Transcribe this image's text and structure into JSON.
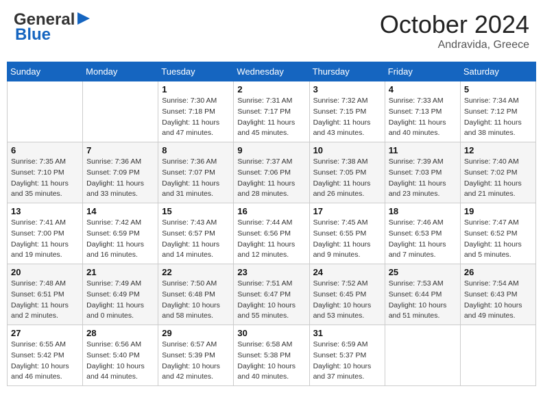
{
  "header": {
    "logo_line1": "General",
    "logo_line2": "Blue",
    "month_title": "October 2024",
    "location": "Andravida, Greece"
  },
  "calendar": {
    "days_of_week": [
      "Sunday",
      "Monday",
      "Tuesday",
      "Wednesday",
      "Thursday",
      "Friday",
      "Saturday"
    ],
    "weeks": [
      [
        {
          "day": "",
          "sunrise": "",
          "sunset": "",
          "daylight": ""
        },
        {
          "day": "",
          "sunrise": "",
          "sunset": "",
          "daylight": ""
        },
        {
          "day": "1",
          "sunrise": "Sunrise: 7:30 AM",
          "sunset": "Sunset: 7:18 PM",
          "daylight": "Daylight: 11 hours and 47 minutes."
        },
        {
          "day": "2",
          "sunrise": "Sunrise: 7:31 AM",
          "sunset": "Sunset: 7:17 PM",
          "daylight": "Daylight: 11 hours and 45 minutes."
        },
        {
          "day": "3",
          "sunrise": "Sunrise: 7:32 AM",
          "sunset": "Sunset: 7:15 PM",
          "daylight": "Daylight: 11 hours and 43 minutes."
        },
        {
          "day": "4",
          "sunrise": "Sunrise: 7:33 AM",
          "sunset": "Sunset: 7:13 PM",
          "daylight": "Daylight: 11 hours and 40 minutes."
        },
        {
          "day": "5",
          "sunrise": "Sunrise: 7:34 AM",
          "sunset": "Sunset: 7:12 PM",
          "daylight": "Daylight: 11 hours and 38 minutes."
        }
      ],
      [
        {
          "day": "6",
          "sunrise": "Sunrise: 7:35 AM",
          "sunset": "Sunset: 7:10 PM",
          "daylight": "Daylight: 11 hours and 35 minutes."
        },
        {
          "day": "7",
          "sunrise": "Sunrise: 7:36 AM",
          "sunset": "Sunset: 7:09 PM",
          "daylight": "Daylight: 11 hours and 33 minutes."
        },
        {
          "day": "8",
          "sunrise": "Sunrise: 7:36 AM",
          "sunset": "Sunset: 7:07 PM",
          "daylight": "Daylight: 11 hours and 31 minutes."
        },
        {
          "day": "9",
          "sunrise": "Sunrise: 7:37 AM",
          "sunset": "Sunset: 7:06 PM",
          "daylight": "Daylight: 11 hours and 28 minutes."
        },
        {
          "day": "10",
          "sunrise": "Sunrise: 7:38 AM",
          "sunset": "Sunset: 7:05 PM",
          "daylight": "Daylight: 11 hours and 26 minutes."
        },
        {
          "day": "11",
          "sunrise": "Sunrise: 7:39 AM",
          "sunset": "Sunset: 7:03 PM",
          "daylight": "Daylight: 11 hours and 23 minutes."
        },
        {
          "day": "12",
          "sunrise": "Sunrise: 7:40 AM",
          "sunset": "Sunset: 7:02 PM",
          "daylight": "Daylight: 11 hours and 21 minutes."
        }
      ],
      [
        {
          "day": "13",
          "sunrise": "Sunrise: 7:41 AM",
          "sunset": "Sunset: 7:00 PM",
          "daylight": "Daylight: 11 hours and 19 minutes."
        },
        {
          "day": "14",
          "sunrise": "Sunrise: 7:42 AM",
          "sunset": "Sunset: 6:59 PM",
          "daylight": "Daylight: 11 hours and 16 minutes."
        },
        {
          "day": "15",
          "sunrise": "Sunrise: 7:43 AM",
          "sunset": "Sunset: 6:57 PM",
          "daylight": "Daylight: 11 hours and 14 minutes."
        },
        {
          "day": "16",
          "sunrise": "Sunrise: 7:44 AM",
          "sunset": "Sunset: 6:56 PM",
          "daylight": "Daylight: 11 hours and 12 minutes."
        },
        {
          "day": "17",
          "sunrise": "Sunrise: 7:45 AM",
          "sunset": "Sunset: 6:55 PM",
          "daylight": "Daylight: 11 hours and 9 minutes."
        },
        {
          "day": "18",
          "sunrise": "Sunrise: 7:46 AM",
          "sunset": "Sunset: 6:53 PM",
          "daylight": "Daylight: 11 hours and 7 minutes."
        },
        {
          "day": "19",
          "sunrise": "Sunrise: 7:47 AM",
          "sunset": "Sunset: 6:52 PM",
          "daylight": "Daylight: 11 hours and 5 minutes."
        }
      ],
      [
        {
          "day": "20",
          "sunrise": "Sunrise: 7:48 AM",
          "sunset": "Sunset: 6:51 PM",
          "daylight": "Daylight: 11 hours and 2 minutes."
        },
        {
          "day": "21",
          "sunrise": "Sunrise: 7:49 AM",
          "sunset": "Sunset: 6:49 PM",
          "daylight": "Daylight: 11 hours and 0 minutes."
        },
        {
          "day": "22",
          "sunrise": "Sunrise: 7:50 AM",
          "sunset": "Sunset: 6:48 PM",
          "daylight": "Daylight: 10 hours and 58 minutes."
        },
        {
          "day": "23",
          "sunrise": "Sunrise: 7:51 AM",
          "sunset": "Sunset: 6:47 PM",
          "daylight": "Daylight: 10 hours and 55 minutes."
        },
        {
          "day": "24",
          "sunrise": "Sunrise: 7:52 AM",
          "sunset": "Sunset: 6:45 PM",
          "daylight": "Daylight: 10 hours and 53 minutes."
        },
        {
          "day": "25",
          "sunrise": "Sunrise: 7:53 AM",
          "sunset": "Sunset: 6:44 PM",
          "daylight": "Daylight: 10 hours and 51 minutes."
        },
        {
          "day": "26",
          "sunrise": "Sunrise: 7:54 AM",
          "sunset": "Sunset: 6:43 PM",
          "daylight": "Daylight: 10 hours and 49 minutes."
        }
      ],
      [
        {
          "day": "27",
          "sunrise": "Sunrise: 6:55 AM",
          "sunset": "Sunset: 5:42 PM",
          "daylight": "Daylight: 10 hours and 46 minutes."
        },
        {
          "day": "28",
          "sunrise": "Sunrise: 6:56 AM",
          "sunset": "Sunset: 5:40 PM",
          "daylight": "Daylight: 10 hours and 44 minutes."
        },
        {
          "day": "29",
          "sunrise": "Sunrise: 6:57 AM",
          "sunset": "Sunset: 5:39 PM",
          "daylight": "Daylight: 10 hours and 42 minutes."
        },
        {
          "day": "30",
          "sunrise": "Sunrise: 6:58 AM",
          "sunset": "Sunset: 5:38 PM",
          "daylight": "Daylight: 10 hours and 40 minutes."
        },
        {
          "day": "31",
          "sunrise": "Sunrise: 6:59 AM",
          "sunset": "Sunset: 5:37 PM",
          "daylight": "Daylight: 10 hours and 37 minutes."
        },
        {
          "day": "",
          "sunrise": "",
          "sunset": "",
          "daylight": ""
        },
        {
          "day": "",
          "sunrise": "",
          "sunset": "",
          "daylight": ""
        }
      ]
    ]
  }
}
